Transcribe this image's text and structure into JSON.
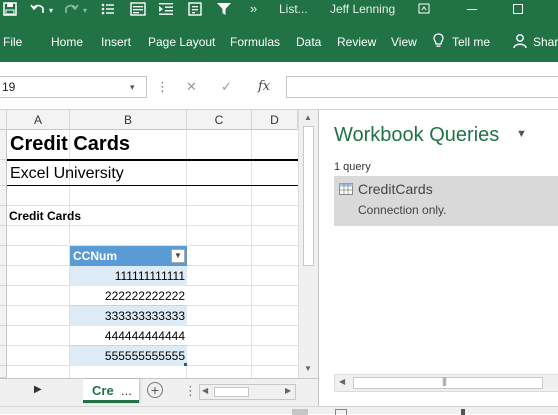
{
  "titlebar": {
    "title": "List...",
    "user": "Jeff Lenning",
    "save_icon": "save-icon",
    "undo_icon": "undo-icon",
    "redo_icon": "redo-icon",
    "more_label": "»"
  },
  "ribbon": {
    "tabs": [
      "File",
      "Home",
      "Insert",
      "Page Layout",
      "Formulas",
      "Data",
      "Review",
      "View"
    ],
    "tell_me": "Tell me",
    "share": "Share"
  },
  "formula_bar": {
    "name_box": "19",
    "cancel": "✕",
    "enter": "✓",
    "fx": "fx",
    "value": ""
  },
  "sheet": {
    "columns": [
      "A",
      "B",
      "C",
      "D"
    ],
    "title": "Credit Cards",
    "subtitle": "Excel University",
    "section_label": "Credit Cards",
    "table": {
      "header": "CCNum",
      "rows": [
        "111111111111",
        "222222222222",
        "333333333333",
        "444444444444",
        "555555555555"
      ]
    },
    "colors": {
      "table_header": "#5b9bd5",
      "band_light": "#ddebf7"
    }
  },
  "sheet_tabs": {
    "active_tab": "Cre",
    "ellipsis": "..."
  },
  "queries_pane": {
    "title": "Workbook Queries",
    "count": "1 query",
    "query_name": "CreditCards",
    "query_status": "Connection only."
  },
  "colors": {
    "brand": "#217346"
  }
}
